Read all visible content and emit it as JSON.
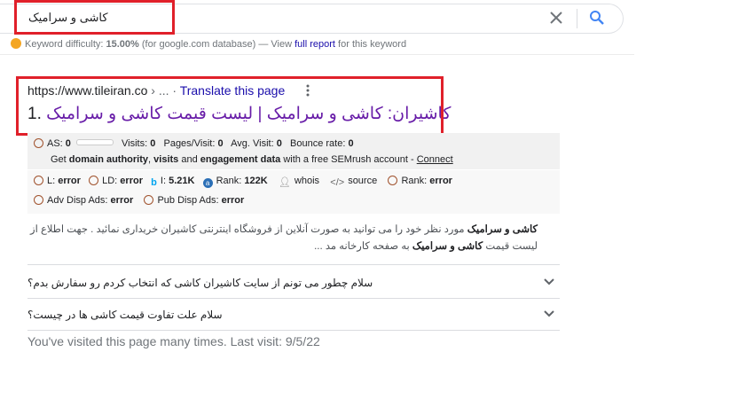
{
  "search": {
    "query": "کاشی و سرامیک"
  },
  "keyword_difficulty": {
    "label": "Keyword difficulty:",
    "value": "15.00%",
    "database": "(for google.com database) — View",
    "report_link": "full report",
    "suffix": "for this keyword"
  },
  "result": {
    "url": "https://www.tileiran.co",
    "breadcrumb": "› ... ·",
    "translate": "Translate this page",
    "number": "1.",
    "title": "کاشیران: کاشی و سرامیک | لیست قیمت کاشی و سرامیک"
  },
  "seo": {
    "as_label": "AS:",
    "as_value": "0",
    "visits_label": "Visits:",
    "visits_value": "0",
    "pages_label": "Pages/Visit:",
    "pages_value": "0",
    "avg_label": "Avg. Visit:",
    "avg_value": "0",
    "bounce_label": "Bounce rate:",
    "bounce_value": "0",
    "promo_get": "Get",
    "promo_da": "domain authority",
    "promo_comma": ",",
    "promo_visits": "visits",
    "promo_and": "and",
    "promo_engagement": "engagement data",
    "promo_rest": "with a free SEMrush account -",
    "promo_link": "Connect",
    "l_label": "L:",
    "l_value": "error",
    "ld_label": "LD:",
    "ld_value": "error",
    "i_label": "I:",
    "i_value": "5.21K",
    "rank_label": "Rank:",
    "rank_value": "122K",
    "whois": "whois",
    "source": "source",
    "rank2_label": "Rank:",
    "rank2_value": "error",
    "adv_label": "Adv Disp Ads:",
    "adv_value": "error",
    "pub_label": "Pub Disp Ads:",
    "pub_value": "error"
  },
  "snippet": {
    "bold1": "کاشی و سرامیک",
    "text1": " مورد نظر خود را می توانید به صورت آنلاین از فروشگاه اینترنتی کاشیران خریداری نمائید . جهت اطلاع از",
    "text2": "لیست قیمت ",
    "bold2": "کاشی و سرامیک",
    "text3": " به صفحه کارخانه مد ..."
  },
  "faq": [
    {
      "question": "سلام چطور می تونم از سایت کاشیران کاشی که انتخاب کردم رو سفارش بدم؟"
    },
    {
      "question": "سلام علت تفاوت قیمت کاشی ها در چیست؟"
    }
  ],
  "visited": "You've visited this page many times. Last visit: 9/5/22",
  "colors": {
    "highlight_box": "#e0202a",
    "link": "#1a0dab",
    "title_visited": "#681da8"
  }
}
